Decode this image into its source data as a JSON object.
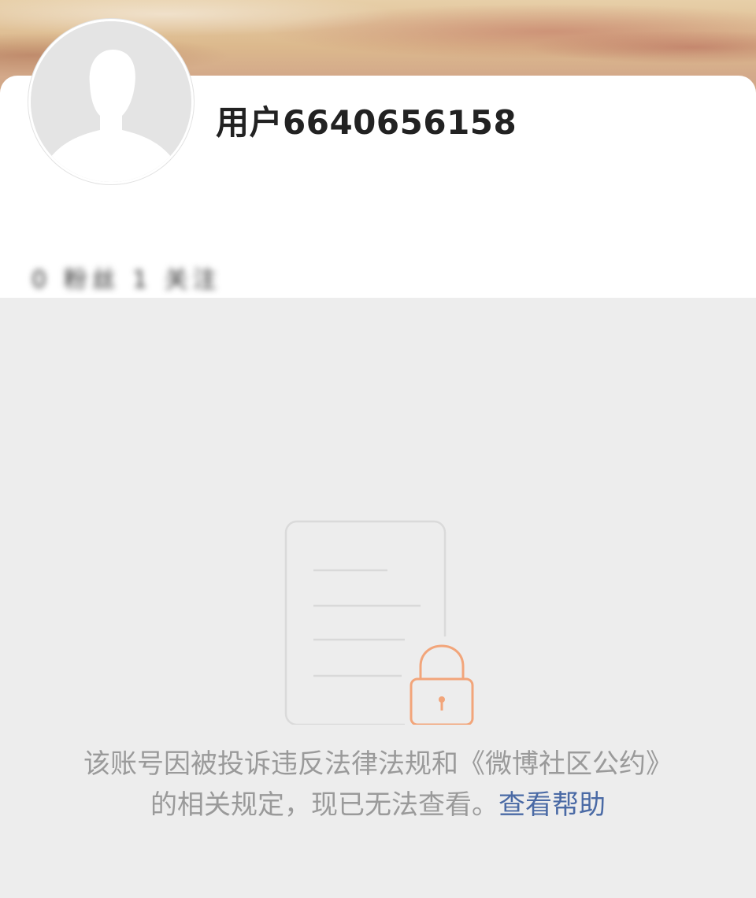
{
  "profile": {
    "username": "用户6640656158",
    "stats_blurred": "0 粉丝 1 关注"
  },
  "notice": {
    "text": "该账号因被投诉违反法律法规和《微博社区公约》的相关规定，现已无法查看。",
    "help_link": "查看帮助"
  },
  "colors": {
    "page_bg": "#ededed",
    "lock_accent": "#f2a57a",
    "link": "#4a6aa5",
    "notice_text": "#9a9a9a"
  },
  "icons": {
    "avatar": "default-avatar-silhouette",
    "illustration": "locked-document-icon"
  }
}
